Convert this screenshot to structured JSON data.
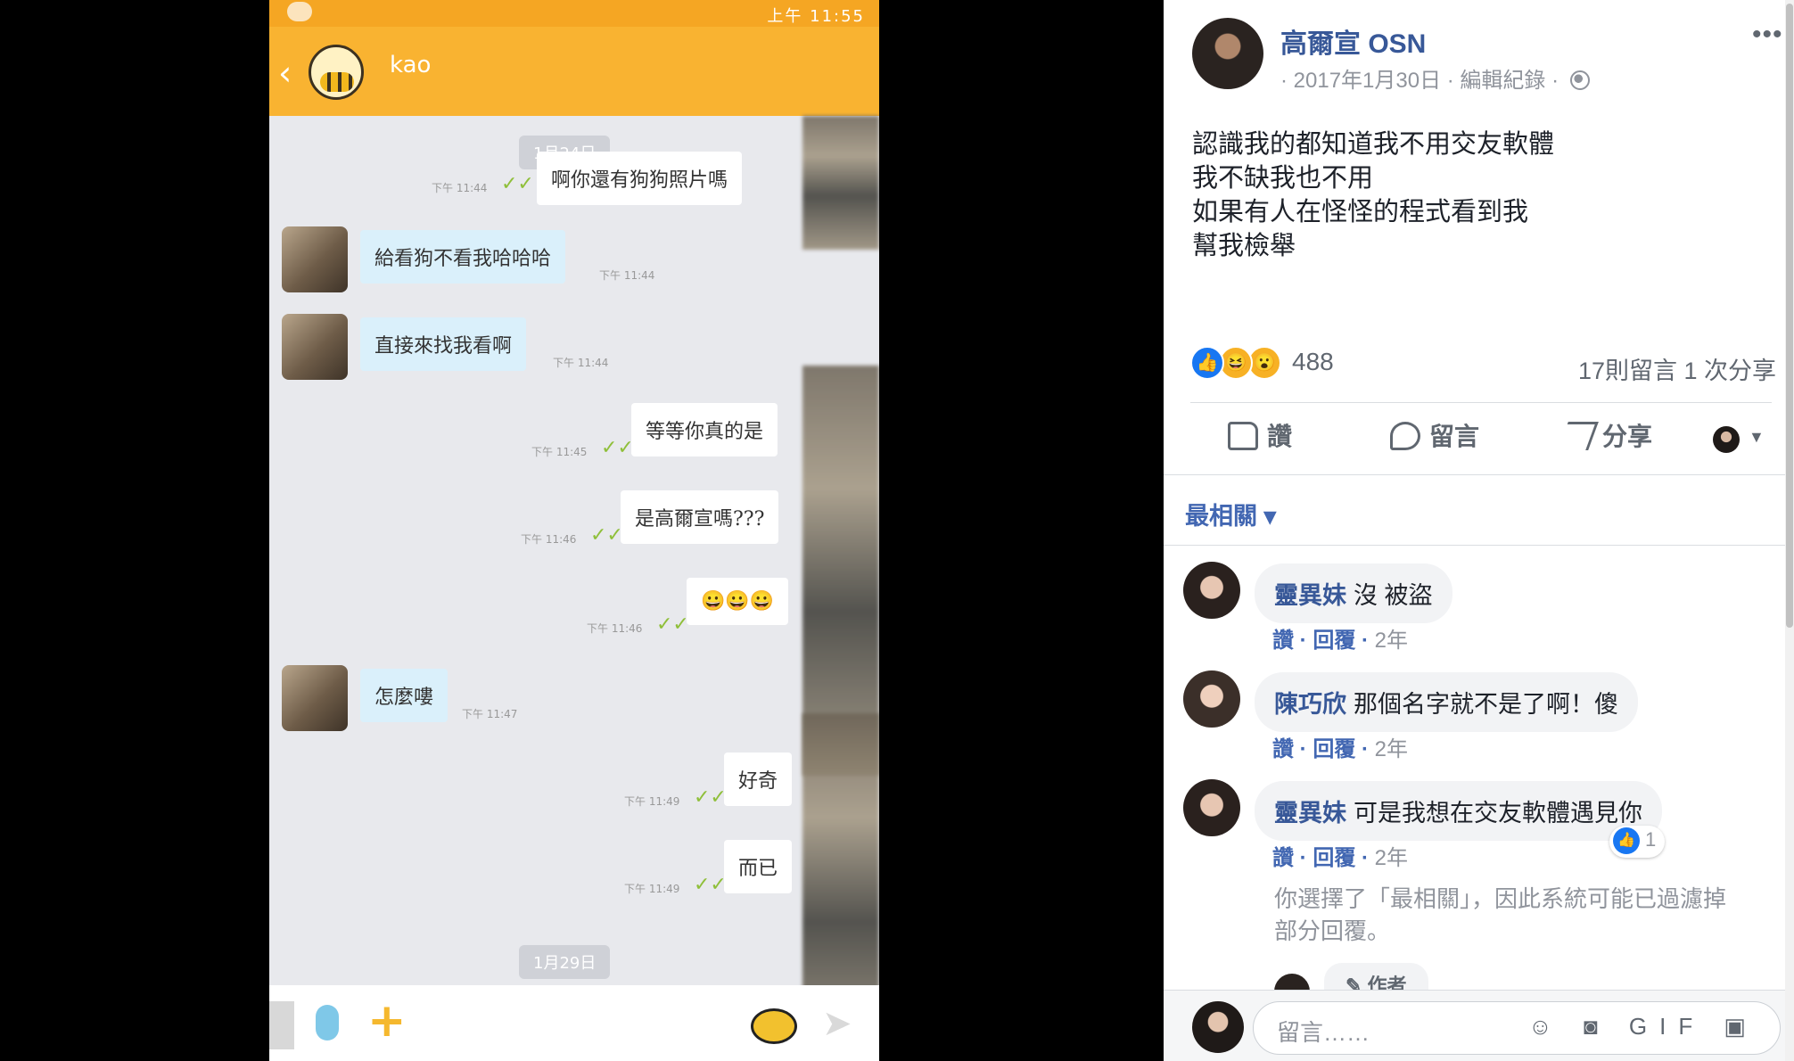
{
  "chat": {
    "status_time": "上午 11:55",
    "contact_name": "kao",
    "date_1": "1月24日",
    "date_2": "1月29日",
    "messages": [
      {
        "side": "me",
        "text": "啊你還有狗狗照片嗎",
        "time": "下午 11:44"
      },
      {
        "side": "them",
        "text": "給看狗不看我哈哈哈",
        "time": "下午 11:44"
      },
      {
        "side": "them",
        "text": "直接來找我看啊",
        "time": "下午 11:44"
      },
      {
        "side": "me",
        "text": "等等你真的是",
        "time": "下午 11:45"
      },
      {
        "side": "me",
        "text": "是高爾宣嗎???",
        "time": "下午 11:46"
      },
      {
        "side": "me",
        "text": "😀😀😀",
        "time": "下午 11:46"
      },
      {
        "side": "them",
        "text": "怎麼嘍",
        "time": "下午 11:47"
      },
      {
        "side": "me",
        "text": "好奇",
        "time": "下午 11:49"
      },
      {
        "side": "me",
        "text": "而已",
        "time": "下午 11:49"
      }
    ],
    "ticks": "✓✓",
    "send_icon": "➤"
  },
  "post": {
    "author": "高爾宣 OSN",
    "date": "· 2017年1月30日 · 編輯紀錄 ·",
    "more": "•••",
    "body": [
      "認識我的都知道我不用交友軟體",
      "我不缺我也不用",
      "如果有人在怪怪的程式看到我",
      "幫我檢舉"
    ],
    "reactions": {
      "like": "👍",
      "haha": "😆",
      "wow": "😮",
      "count": "488"
    },
    "stats": "17則留言  1 次分享",
    "actions": {
      "like": "讚",
      "comment": "留言",
      "share": "分享"
    },
    "sort": "最相關 ▾"
  },
  "comments": [
    {
      "name": "靈異妹",
      "text": "沒 被盜",
      "like": "讚",
      "reply": "回覆",
      "age": "2年"
    },
    {
      "name": "陳巧欣",
      "text": "那個名字就不是了啊！傻",
      "like": "讚",
      "reply": "回覆",
      "age": "2年"
    },
    {
      "name": "靈異妹",
      "text": "可是我想在交友軟體遇見你",
      "like": "讚",
      "reply": "回覆",
      "age": "2年",
      "likes": "1"
    }
  ],
  "filter_note": [
    "你選擇了「最相關」，因此系統可能已過濾掉",
    "部分回覆。"
  ],
  "author_chip": "✎ 作者",
  "composer": {
    "placeholder": "留言……",
    "tools": "☺ ◙ GIF ▣"
  },
  "colors": {
    "brand_blue": "#385898",
    "line_orange": "#f9b331",
    "check_green": "#8fbf3a"
  }
}
